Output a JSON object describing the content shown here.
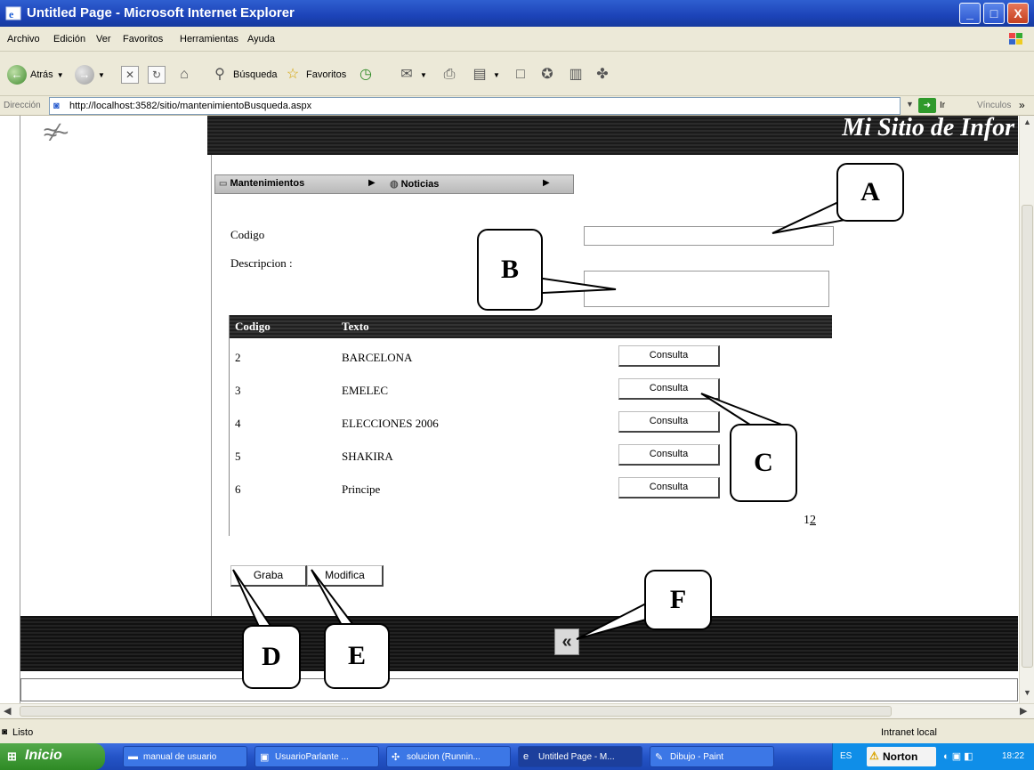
{
  "window": {
    "title": "Untitled Page - Microsoft Internet Explorer",
    "minimize": "_",
    "maximize": "□",
    "close": "X"
  },
  "menu": [
    "Archivo",
    "Edición",
    "Ver",
    "Favoritos",
    "Herramientas",
    "Ayuda"
  ],
  "toolbar": {
    "back_label": "Atrás",
    "search_label": "Búsqueda",
    "favorites_label": "Favoritos"
  },
  "address": {
    "label": "Dirección",
    "url": "http://localhost:3582/sitio/mantenimientoBusqueda.aspx",
    "go_label": "Ir",
    "links_label": "Vínculos",
    "chevron": "»"
  },
  "site": {
    "header_title": "Mi Sitio de Infor",
    "menu": {
      "item1": "Mantenimientos",
      "item2": "Noticias"
    }
  },
  "form": {
    "codigo_label": "Codigo",
    "descripcion_label": "Descripcion :",
    "codigo_value": "",
    "descripcion_value": ""
  },
  "grid": {
    "headers": [
      "Codigo",
      "Texto"
    ],
    "button_label": "Consulta",
    "rows": [
      {
        "codigo": "2",
        "texto": "BARCELONA"
      },
      {
        "codigo": "3",
        "texto": "EMELEC"
      },
      {
        "codigo": "4",
        "texto": "ELECCIONES 2006"
      },
      {
        "codigo": "5",
        "texto": "SHAKIRA"
      },
      {
        "codigo": "6",
        "texto": "Principe"
      }
    ],
    "pager": {
      "current": "1",
      "next": "2"
    }
  },
  "actions": {
    "graba": "Graba",
    "modifica": "Modifica",
    "back": "«"
  },
  "callouts": {
    "a": "A",
    "b": "B",
    "c": "C",
    "d": "D",
    "e": "E",
    "f": "F"
  },
  "status": {
    "text": "Listo",
    "zone": "Intranet local"
  },
  "taskbar": {
    "start": "Inicio",
    "tasks": [
      "manual de usuario",
      "UsuarioParlante ...",
      "solucion (Runnin...",
      "Untitled Page - M...",
      "Dibujo - Paint"
    ],
    "lang": "ES",
    "norton": "Norton",
    "clock": "18:22"
  },
  "colors": {
    "titlebar": "#1c43b8",
    "chrome": "#ece9d8",
    "band": "#1f1f1f",
    "taskbar": "#2454c7",
    "start": "#2e8a25"
  },
  "icons": [
    "ie-icon",
    "back-icon",
    "forward-icon",
    "stop-icon",
    "refresh-icon",
    "home-icon",
    "search-icon",
    "favorites-icon",
    "history-icon",
    "mail-icon",
    "print-icon",
    "go-icon",
    "windows-flag-icon"
  ]
}
